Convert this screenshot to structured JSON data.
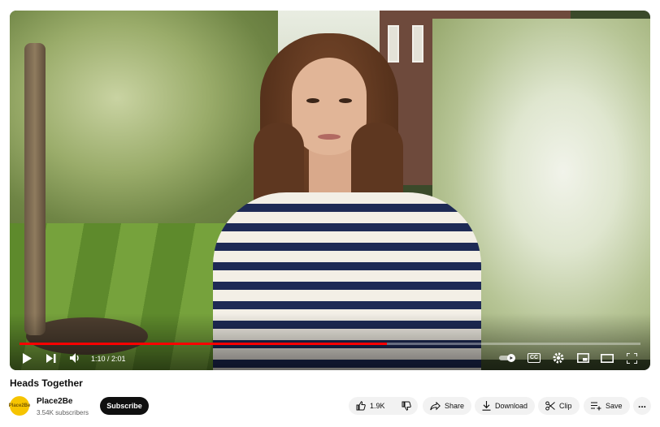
{
  "video": {
    "title": "Heads Together",
    "time_display": "1:10 / 2:01",
    "progress_fraction": 0.592,
    "progress_color": "#ff0000"
  },
  "controls": {
    "icons": [
      "play-icon",
      "next-icon",
      "volume-icon",
      "autoplay-toggle-icon",
      "cc-icon",
      "settings-icon",
      "miniplayer-icon",
      "theater-icon",
      "fullscreen-icon"
    ],
    "cc_label": "CC"
  },
  "channel": {
    "name": "Place2Be",
    "subscribers": "3.54K subscribers",
    "avatar_text": "Place2Be",
    "subscribe_label": "Subscribe"
  },
  "actions": {
    "like_count": "1.9K",
    "share_label": "Share",
    "download_label": "Download",
    "clip_label": "Clip",
    "save_label": "Save",
    "more_label": "..."
  }
}
